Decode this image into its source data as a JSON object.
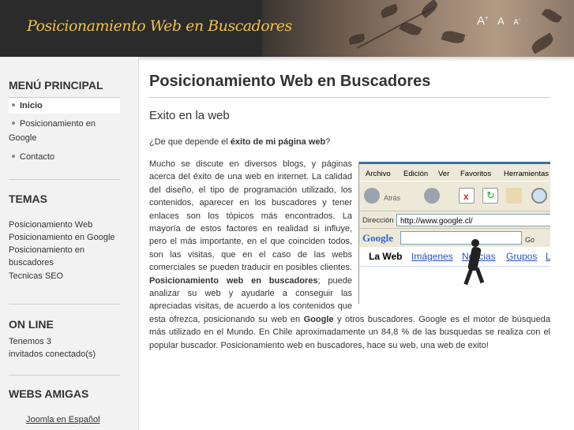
{
  "header": {
    "site_title": "Posicionamiento Web en Buscadores",
    "font_tools": {
      "increase": "A",
      "increase_sup": "+",
      "reset": "A",
      "decrease": "A",
      "decrease_sup": "-"
    }
  },
  "sidebar": {
    "main_menu": {
      "title": "MENÚ PRINCIPAL",
      "items": [
        {
          "label": "Inicio",
          "active": true
        },
        {
          "label_line1": "Posicionamiento en",
          "label_line2": "Google"
        },
        {
          "label": "Contacto"
        }
      ]
    },
    "topics": {
      "title": "TEMAS",
      "items": [
        "Posicionamiento Web",
        "Posicionamiento en Google",
        "Posicionamiento en",
        "buscadores",
        "Tecnicas SEO"
      ]
    },
    "online": {
      "title": "ON LINE",
      "line1": "Tenemos 3",
      "line2": "invitados conectado(s)"
    },
    "friends": {
      "title": "WEBS AMIGAS",
      "items": [
        "Joomla en Español"
      ]
    }
  },
  "content": {
    "page_title": "Posicionamiento Web en Buscadores",
    "article_title": "Exito en la web",
    "question_prefix": "¿De que depende el ",
    "question_bold": "éxito de mi página web",
    "question_suffix": "?",
    "para_1": "Mucho se discute en diversos blogs, y páginas acerca del éxito de una web en internet.  La calidad del diseño, el tipo de programación utilizado, los contenidos, aparecer en los buscadores y tener enlaces son los tópicos más encontrados.  La mayoría de estos factores en realidad si influye, pero el más importante, en el que coinciden todos, son las visitas, que en el caso de las webs comerciales se pueden traducir en posibles clientes. ",
    "para_bold_1": "Posicionamiento web en buscadores",
    "para_2": "; puede analizar su web y ayudarle a conseguir las apreciadas visitas, de acuerdo a los contenidos que esta ofrezca, posicionando su web en ",
    "para_bold_2": "Google",
    "para_3": " y otros buscadores.  Google es el motor de búsqueda más utilizado en el Mundo. En Chile aproximadamente un 84,8 % de las busquedas se realiza con el popular buscador. Posicionamiento web en buscadores, hace su web, una web de exito!"
  },
  "figure": {
    "menu": [
      "Archivo",
      "Edición",
      "Ver",
      "Favoritos",
      "Herramientas"
    ],
    "back_label": "Atrás",
    "address_label": "Dirección",
    "address_value": "http://www.google.cl/",
    "google_logo": "Google",
    "go_label": "Go",
    "page_links": [
      "La Web",
      "Imágenes",
      "Noticias",
      "Grupos",
      "L"
    ]
  },
  "colors": {
    "header_bg": "#2b2b2b",
    "site_title": "#f0c24a",
    "sidebar_bg": "#f2f2f2",
    "text": "#333333"
  }
}
